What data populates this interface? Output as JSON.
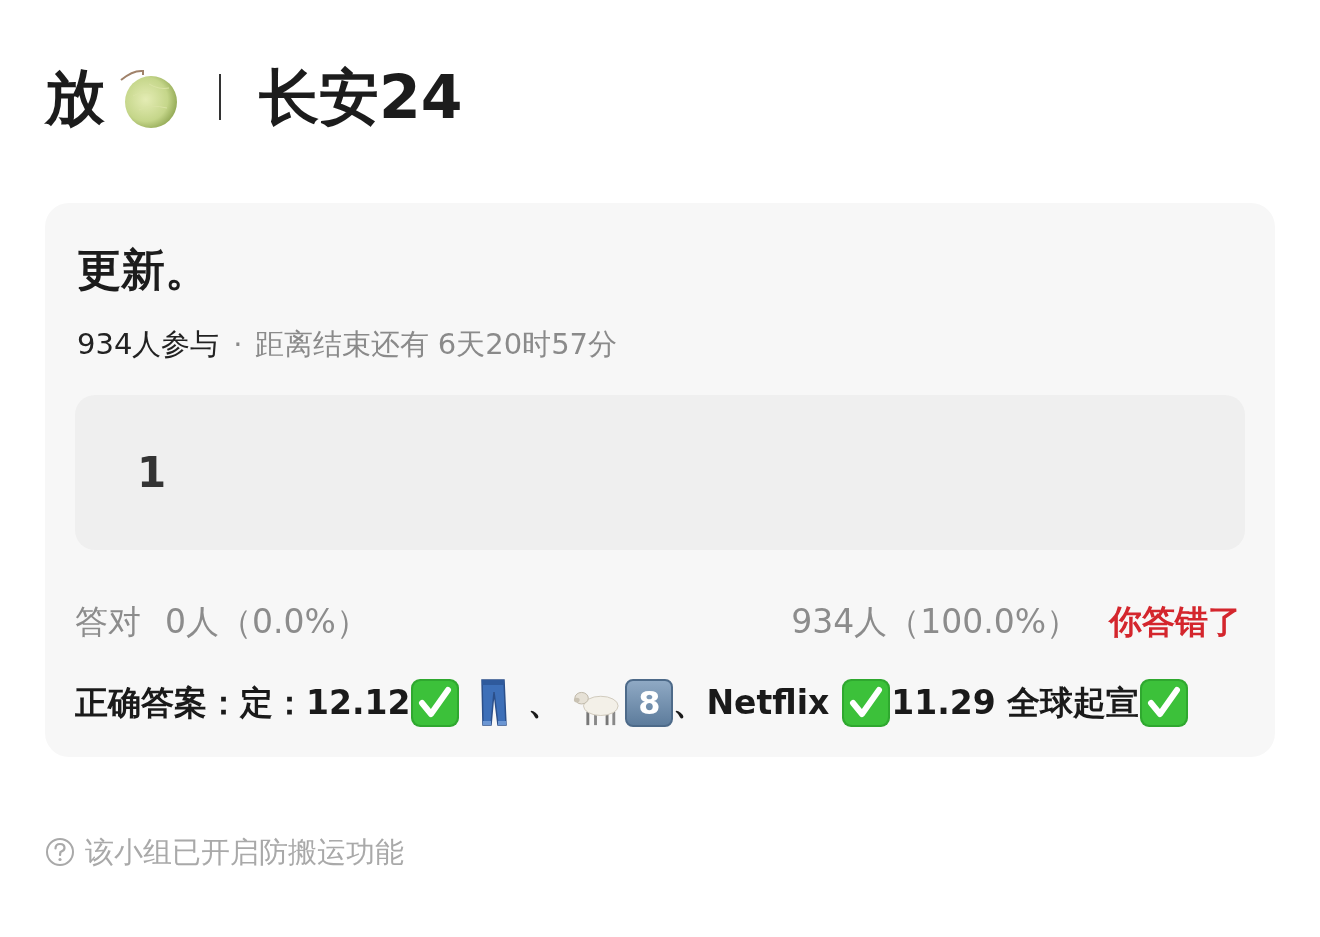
{
  "header": {
    "title_left": "放",
    "title_right": "长安24"
  },
  "poll": {
    "title": "更新。",
    "participants": "934人参与",
    "separator": "·",
    "countdown": "距离结束还有 6天20时57分",
    "options": [
      {
        "label": "1"
      }
    ],
    "result": {
      "correct_label": "答对",
      "correct_count": "0人（0.0%）",
      "wrong_count": "934人（100.0%）",
      "verdict": "你答错了",
      "user_correct": false
    },
    "answer_line": {
      "text_1": "正确答案：定：12.12",
      "text_2": "、",
      "keycap_digit": "8",
      "text_3": "、Netflix",
      "text_4": "11.29 全球起宣"
    }
  },
  "footer_note": "该小组已开启防搬运功能"
}
